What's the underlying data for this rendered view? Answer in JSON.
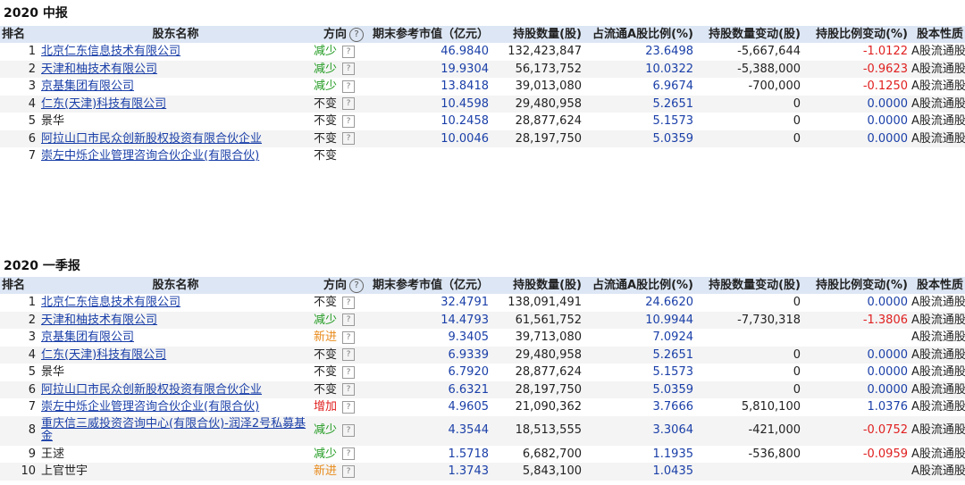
{
  "sections": [
    {
      "title": "2020 中报",
      "headers": {
        "rank": "排名",
        "name": "股东名称",
        "direction": "方向",
        "help": "?",
        "value": "期末参考市值（亿元）",
        "shares": "持股数量(股)",
        "ratio": "占流通A股比例(%)",
        "change": "持股数量变动(股)",
        "ratio_change": "持股比例变动(%)",
        "type": "股本性质"
      },
      "rows": [
        {
          "rank": "1",
          "name": "北京仁东信息技术有限公司",
          "link": true,
          "direction": "减少",
          "dir_color": "green",
          "value": "46.9840",
          "shares": "132,423,847",
          "ratio": "23.6498",
          "change": "-5,667,644",
          "ratio_change": "-1.0122",
          "rc_color": "red",
          "type": "A股流通股"
        },
        {
          "rank": "2",
          "name": "天津和柚技术有限公司",
          "link": true,
          "direction": "减少",
          "dir_color": "green",
          "value": "19.9304",
          "shares": "56,173,752",
          "ratio": "10.0322",
          "change": "-5,388,000",
          "ratio_change": "-0.9623",
          "rc_color": "red",
          "type": "A股流通股"
        },
        {
          "rank": "3",
          "name": "京基集团有限公司",
          "link": true,
          "direction": "减少",
          "dir_color": "green",
          "value": "13.8418",
          "shares": "39,013,080",
          "ratio": "6.9674",
          "change": "-700,000",
          "ratio_change": "-0.1250",
          "rc_color": "red",
          "type": "A股流通股"
        },
        {
          "rank": "4",
          "name": "仁东(天津)科技有限公司",
          "link": true,
          "direction": "不变",
          "dir_color": "black",
          "value": "10.4598",
          "shares": "29,480,958",
          "ratio": "5.2651",
          "change": "0",
          "ratio_change": "0.0000",
          "rc_color": "blue",
          "type": "A股流通股"
        },
        {
          "rank": "5",
          "name": "景华",
          "link": false,
          "direction": "不变",
          "dir_color": "black",
          "value": "10.2458",
          "shares": "28,877,624",
          "ratio": "5.1573",
          "change": "0",
          "ratio_change": "0.0000",
          "rc_color": "blue",
          "type": "A股流通股"
        },
        {
          "rank": "6",
          "name": "阿拉山口市民众创新股权投资有限合伙企业",
          "link": true,
          "direction": "不变",
          "dir_color": "black",
          "value": "10.0046",
          "shares": "28,197,750",
          "ratio": "5.0359",
          "change": "0",
          "ratio_change": "0.0000",
          "rc_color": "blue",
          "type": "A股流通股"
        },
        {
          "rank": "7",
          "name": "崇左中烁企业管理咨询合伙企业(有限合伙)",
          "link": true,
          "direction": "不变",
          "dir_color": "black",
          "value": "",
          "shares": "",
          "ratio": "",
          "change": "",
          "ratio_change": "",
          "rc_color": "blue",
          "type": "",
          "partial": true
        }
      ]
    },
    {
      "title": "2020 一季报",
      "headers": {
        "rank": "排名",
        "name": "股东名称",
        "direction": "方向",
        "help": "?",
        "value": "期末参考市值（亿元）",
        "shares": "持股数量(股)",
        "ratio": "占流通A股比例(%)",
        "change": "持股数量变动(股)",
        "ratio_change": "持股比例变动(%)",
        "type": "股本性质"
      },
      "rows": [
        {
          "rank": "1",
          "name": "北京仁东信息技术有限公司",
          "link": true,
          "direction": "不变",
          "dir_color": "black",
          "value": "32.4791",
          "shares": "138,091,491",
          "ratio": "24.6620",
          "change": "0",
          "ratio_change": "0.0000",
          "rc_color": "blue",
          "type": "A股流通股"
        },
        {
          "rank": "2",
          "name": "天津和柚技术有限公司",
          "link": true,
          "direction": "减少",
          "dir_color": "green",
          "value": "14.4793",
          "shares": "61,561,752",
          "ratio": "10.9944",
          "change": "-7,730,318",
          "ratio_change": "-1.3806",
          "rc_color": "red",
          "type": "A股流通股"
        },
        {
          "rank": "3",
          "name": "京基集团有限公司",
          "link": true,
          "direction": "新进",
          "dir_color": "orange",
          "value": "9.3405",
          "shares": "39,713,080",
          "ratio": "7.0924",
          "change": "",
          "ratio_change": "",
          "rc_color": "blue",
          "type": "A股流通股"
        },
        {
          "rank": "4",
          "name": "仁东(天津)科技有限公司",
          "link": true,
          "direction": "不变",
          "dir_color": "black",
          "value": "6.9339",
          "shares": "29,480,958",
          "ratio": "5.2651",
          "change": "0",
          "ratio_change": "0.0000",
          "rc_color": "blue",
          "type": "A股流通股"
        },
        {
          "rank": "5",
          "name": "景华",
          "link": false,
          "direction": "不变",
          "dir_color": "black",
          "value": "6.7920",
          "shares": "28,877,624",
          "ratio": "5.1573",
          "change": "0",
          "ratio_change": "0.0000",
          "rc_color": "blue",
          "type": "A股流通股"
        },
        {
          "rank": "6",
          "name": "阿拉山口市民众创新股权投资有限合伙企业",
          "link": true,
          "direction": "不变",
          "dir_color": "black",
          "value": "6.6321",
          "shares": "28,197,750",
          "ratio": "5.0359",
          "change": "0",
          "ratio_change": "0.0000",
          "rc_color": "blue",
          "type": "A股流通股"
        },
        {
          "rank": "7",
          "name": "崇左中烁企业管理咨询合伙企业(有限合伙)",
          "link": true,
          "direction": "增加",
          "dir_color": "red",
          "value": "4.9605",
          "shares": "21,090,362",
          "ratio": "3.7666",
          "change": "5,810,100",
          "ratio_change": "1.0376",
          "rc_color": "blue",
          "type": "A股流通股"
        },
        {
          "rank": "8",
          "name": "重庆信三威投资咨询中心(有限合伙)-润泽2号私募基金",
          "link": true,
          "direction": "减少",
          "dir_color": "green",
          "value": "4.3544",
          "shares": "18,513,555",
          "ratio": "3.3064",
          "change": "-421,000",
          "ratio_change": "-0.0752",
          "rc_color": "red",
          "type": "A股流通股",
          "tall": true
        },
        {
          "rank": "9",
          "name": "王逑",
          "link": false,
          "direction": "减少",
          "dir_color": "green",
          "value": "1.5718",
          "shares": "6,682,700",
          "ratio": "1.1935",
          "change": "-536,800",
          "ratio_change": "-0.0959",
          "rc_color": "red",
          "type": "A股流通股"
        },
        {
          "rank": "10",
          "name": "上官世宇",
          "link": false,
          "direction": "新进",
          "dir_color": "orange",
          "value": "1.3743",
          "shares": "5,843,100",
          "ratio": "1.0435",
          "change": "",
          "ratio_change": "",
          "rc_color": "blue",
          "type": "A股流通股"
        }
      ]
    }
  ],
  "qbox_glyph": "?"
}
